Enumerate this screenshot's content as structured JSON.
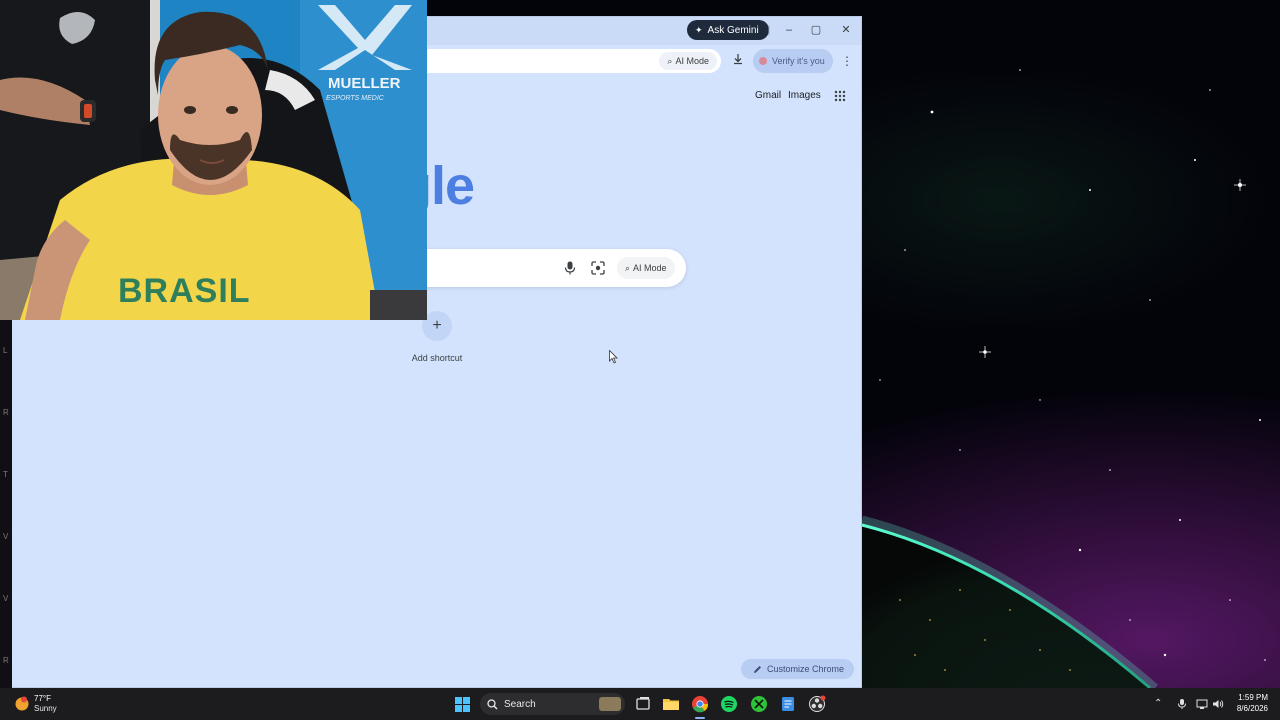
{
  "browser": {
    "ask_gemini_label": "Ask Gemini",
    "omnibox_ai_mode_label": "AI Mode",
    "verify_label": "Verify it's you",
    "gmail_label": "Gmail",
    "images_label": "Images",
    "logo_text": "ogle",
    "search_ai_mode_label": "AI Mode",
    "add_shortcut_label": "Add shortcut",
    "customize_label": "Customize Chrome"
  },
  "webcam": {
    "shirt_text": "BRASIL",
    "banner_text": "MUELLER",
    "banner_subtext": "ESPORTS MEDIC"
  },
  "taskbar": {
    "weather_temp": "77°F",
    "weather_condition": "Sunny",
    "search_label": "Search",
    "time": "1:59 PM",
    "date": "8/6/2026"
  },
  "icons": {
    "gemini": "gemini-star-icon",
    "download": "download-icon",
    "mic": "mic-icon",
    "lens": "lens-icon",
    "apps": "apps-grid-icon",
    "pencil": "pencil-icon"
  },
  "colors": {
    "browser_bg": "#d3e3fd",
    "google_blue": "#4d7fe3",
    "taskbar_bg": "#1c1c1f"
  }
}
